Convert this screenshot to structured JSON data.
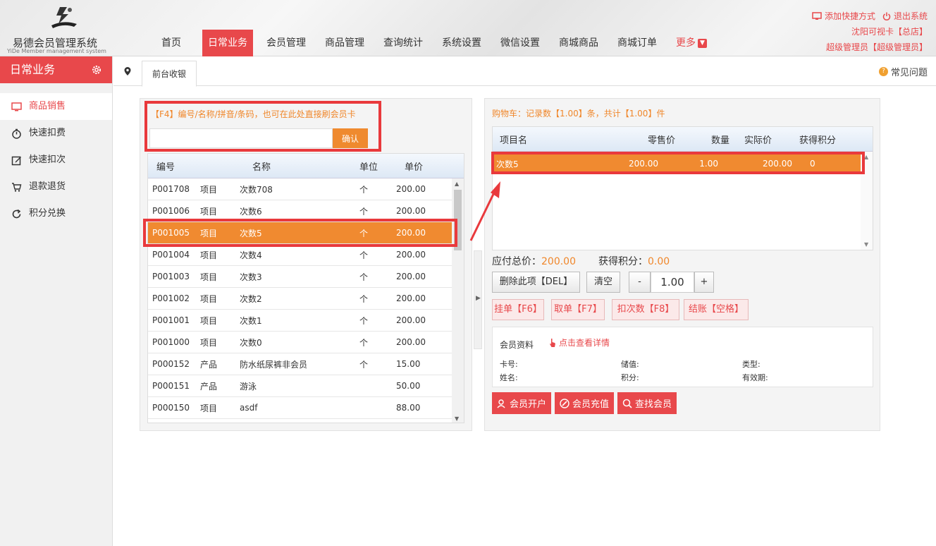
{
  "header": {
    "logo_title": "易德会员管理系统",
    "logo_subtitle": "YiDe Member management system",
    "nav": [
      {
        "label": "首页",
        "active": false
      },
      {
        "label": "日常业务",
        "active": true
      },
      {
        "label": "会员管理",
        "active": false
      },
      {
        "label": "商品管理",
        "active": false
      },
      {
        "label": "查询统计",
        "active": false
      },
      {
        "label": "系统设置",
        "active": false
      },
      {
        "label": "微信设置",
        "active": false
      },
      {
        "label": "商城商品",
        "active": false
      },
      {
        "label": "商城订单",
        "active": false
      }
    ],
    "more_label": "更多",
    "add_shortcut": "添加快捷方式",
    "logout": "退出系统",
    "store": "沈阳可视卡【总店】",
    "user": "超级管理员【超级管理员】",
    "accent_color": "#e8484b"
  },
  "sidebar": {
    "title": "日常业务",
    "items": [
      {
        "label": "商品销售",
        "icon": "monitor-icon",
        "active": true
      },
      {
        "label": "快速扣费",
        "icon": "stopwatch-icon",
        "active": false
      },
      {
        "label": "快速扣次",
        "icon": "edit-icon",
        "active": false
      },
      {
        "label": "退款退货",
        "icon": "cart-return-icon",
        "active": false
      },
      {
        "label": "积分兑换",
        "icon": "refresh-icon",
        "active": false
      }
    ]
  },
  "tabbar": {
    "tab": "前台收银",
    "faq": "常见问题"
  },
  "search": {
    "hint": "【F4】编号/名称/拼音/条码，也可在此处直接刷会员卡",
    "value": "",
    "confirm": "确认"
  },
  "products": {
    "headers": [
      "编号",
      "名称",
      "单位",
      "单价"
    ],
    "rows": [
      [
        "P001708",
        "项目",
        "次数708",
        "个",
        "200.00"
      ],
      [
        "P001006",
        "项目",
        "次数6",
        "个",
        "200.00"
      ],
      [
        "P001005",
        "项目",
        "次数5",
        "个",
        "200.00"
      ],
      [
        "P001004",
        "项目",
        "次数4",
        "个",
        "200.00"
      ],
      [
        "P001003",
        "项目",
        "次数3",
        "个",
        "200.00"
      ],
      [
        "P001002",
        "项目",
        "次数2",
        "个",
        "200.00"
      ],
      [
        "P001001",
        "项目",
        "次数1",
        "个",
        "200.00"
      ],
      [
        "P001000",
        "项目",
        "次数0",
        "个",
        "200.00"
      ],
      [
        "P000152",
        "产品",
        "防水纸尿裤非会员",
        "个",
        "15.00"
      ],
      [
        "P000151",
        "产品",
        "游泳",
        "",
        "50.00"
      ],
      [
        "P000150",
        "项目",
        "asdf",
        "",
        "88.00"
      ]
    ],
    "selected_index": 2
  },
  "cart": {
    "title": "购物车：记录数【1.00】条，共计【1.00】件",
    "headers": [
      "项目名",
      "零售价",
      "数量",
      "实际价",
      "获得积分"
    ],
    "row": {
      "name": "次数5",
      "price": "200.00",
      "qty": "1.00",
      "actual": "200.00",
      "points": "0"
    },
    "total_label": "应付总价：",
    "total_value": "200.00",
    "points_label": "获得积分：",
    "points_value": "0.00",
    "delete_btn": "删除此项【DEL】",
    "clear_btn": "清空",
    "minus": "-",
    "plus": "+",
    "qty_value": "1.00",
    "hold_btn": "挂单【F6】",
    "retrieve_btn": "取单【F7】",
    "deduct_btn": "扣次数【F8】",
    "checkout_btn": "结账【空格】"
  },
  "member": {
    "title": "会员资料",
    "detail_link": "点击查看详情",
    "card_label": "卡号:",
    "balance_label": "储值:",
    "type_label": "类型:",
    "name_label": "姓名:",
    "points_label": "积分:",
    "expiry_label": "有效期:",
    "open_btn": "会员开户",
    "recharge_btn": "会员充值",
    "find_btn": "查找会员"
  }
}
